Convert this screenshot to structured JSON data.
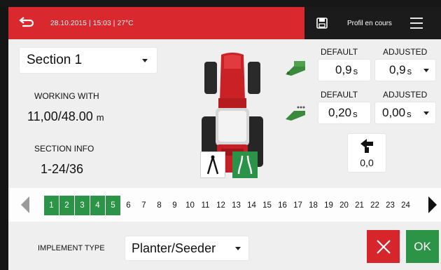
{
  "status": {
    "date": "28.10.2015",
    "time": "15:03",
    "temperature": "27°C",
    "line": "28.10.2015 | 15:03 | 27°C",
    "profile_label": "Profil en cours"
  },
  "icons": {
    "back": "back-arrow-icon",
    "save": "save-icon",
    "menu": "hamburger-menu-icon",
    "tractor": "tractor-top-view-icon",
    "mode_single": "single-implement-mode-icon",
    "mode_double": "double-lane-mode-icon",
    "delay_on": "planter-delay-on-icon",
    "delay_off": "planter-delay-off-icon",
    "offset": "offset-arrow-icon"
  },
  "section": {
    "selected": "Section 1",
    "working_with_label": "WORKING WITH",
    "working_value": "11,00/48.00",
    "working_unit": "m",
    "section_info_label": "SECTION INFO",
    "section_info_value": "1-24/36"
  },
  "timing": {
    "default_label": "DEFAULT",
    "adjusted_label": "ADJUSTED",
    "row1": {
      "default_value": "0,9",
      "default_unit": "s",
      "adjusted_value": "0,9",
      "adjusted_unit": "s"
    },
    "row2": {
      "default_value": "0,20",
      "default_unit": "s",
      "adjusted_value": "0,00",
      "adjusted_unit": "s"
    }
  },
  "offset_value": "0,0",
  "sections_strip": {
    "cells": [
      "1",
      "2",
      "3",
      "4",
      "5",
      "6",
      "7",
      "8",
      "9",
      "10",
      "11",
      "12",
      "13",
      "14",
      "15",
      "16",
      "17",
      "18",
      "19",
      "20",
      "21",
      "22",
      "23",
      "24"
    ],
    "active_count": 5
  },
  "implement": {
    "label": "IMPLEMENT TYPE",
    "selected": "Planter/Seeder"
  },
  "actions": {
    "ok_label": "OK"
  },
  "colors": {
    "header_red": "#d9292e",
    "active_green": "#2c9447",
    "cancel_red": "#d6262b",
    "panel_bg": "#efefef"
  }
}
